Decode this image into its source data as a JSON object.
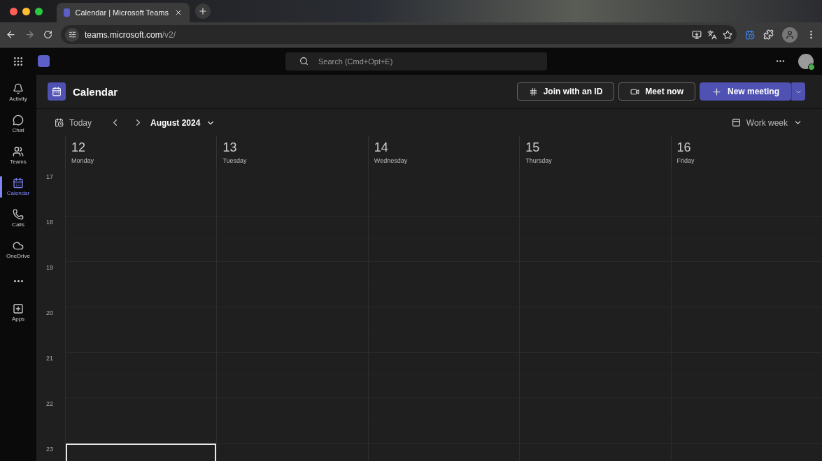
{
  "browser": {
    "tabs": [
      {
        "title": "Calendar | Microsoft Teams",
        "selected": true
      }
    ],
    "url": {
      "host": "teams.microsoft.com",
      "path": "/v2/"
    }
  },
  "search": {
    "placeholder": "Search (Cmd+Opt+E)"
  },
  "rail": [
    {
      "kind": "activity",
      "label": "Activity",
      "selected": false
    },
    {
      "kind": "chat",
      "label": "Chat",
      "selected": false
    },
    {
      "kind": "teams",
      "label": "Teams",
      "selected": false
    },
    {
      "kind": "calendar",
      "label": "Calendar",
      "selected": true
    },
    {
      "kind": "calls",
      "label": "Calls",
      "selected": false
    },
    {
      "kind": "onedrive",
      "label": "OneDrive",
      "selected": false
    },
    {
      "kind": "more",
      "selected": false
    },
    {
      "kind": "apps",
      "label": "Apps",
      "selected": false
    }
  ],
  "page": {
    "title": "Calendar",
    "actions": [
      {
        "kind": "id",
        "label": "Join with an ID"
      },
      {
        "kind": "meet",
        "label": "Meet now"
      },
      {
        "kind": "new",
        "label": "New meeting"
      }
    ]
  },
  "toolbar": {
    "today": "Today",
    "month": "August 2024",
    "view": "Work week"
  },
  "hours": [
    "17",
    "18",
    "19",
    "20",
    "21",
    "22",
    "23"
  ],
  "days": [
    {
      "number": "12",
      "name": "Monday",
      "slots": [
        {
          "selected": false
        },
        {
          "selected": false
        },
        {
          "selected": false
        },
        {
          "selected": false
        },
        {
          "selected": false
        },
        {
          "selected": false
        },
        {
          "selected": true
        }
      ]
    },
    {
      "number": "13",
      "name": "Tuesday",
      "slots": [
        {
          "selected": false
        },
        {
          "selected": false
        },
        {
          "selected": false
        },
        {
          "selected": false
        },
        {
          "selected": false
        },
        {
          "selected": false
        },
        {
          "selected": false
        }
      ]
    },
    {
      "number": "14",
      "name": "Wednesday",
      "slots": [
        {
          "selected": false
        },
        {
          "selected": false
        },
        {
          "selected": false
        },
        {
          "selected": false
        },
        {
          "selected": false
        },
        {
          "selected": false
        },
        {
          "selected": false
        }
      ]
    },
    {
      "number": "15",
      "name": "Thursday",
      "slots": [
        {
          "selected": false
        },
        {
          "selected": false
        },
        {
          "selected": false
        },
        {
          "selected": false
        },
        {
          "selected": false
        },
        {
          "selected": false
        },
        {
          "selected": false
        }
      ]
    },
    {
      "number": "16",
      "name": "Friday",
      "slots": [
        {
          "selected": false
        },
        {
          "selected": false
        },
        {
          "selected": false
        },
        {
          "selected": false
        },
        {
          "selected": false
        },
        {
          "selected": false
        },
        {
          "selected": false
        }
      ]
    }
  ]
}
